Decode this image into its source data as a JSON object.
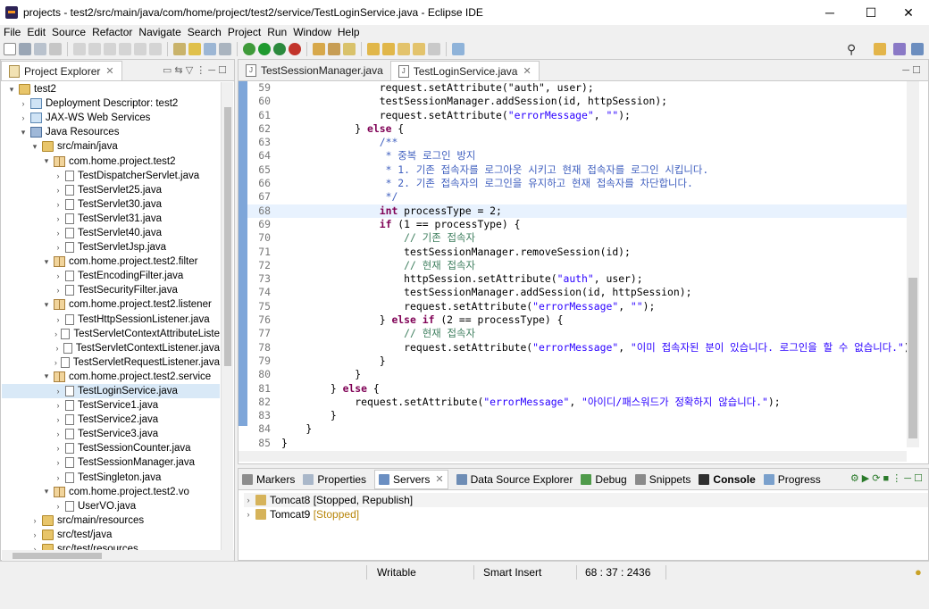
{
  "window": {
    "title": "projects - test2/src/main/java/com/home/project/test2/service/TestLoginService.java - Eclipse IDE",
    "minimize": "─",
    "maximize": "☐",
    "close": "✕"
  },
  "menu": [
    "File",
    "Edit",
    "Source",
    "Refactor",
    "Navigate",
    "Search",
    "Project",
    "Run",
    "Window",
    "Help"
  ],
  "explorer": {
    "tab_label": "Project Explorer",
    "tree": [
      {
        "label": "test2",
        "level": 0,
        "arrow": "▾",
        "icon": "proj"
      },
      {
        "label": "Deployment Descriptor: test2",
        "level": 1,
        "arrow": "›",
        "icon": "desc"
      },
      {
        "label": "JAX-WS Web Services",
        "level": 1,
        "arrow": "›",
        "icon": "desc"
      },
      {
        "label": "Java Resources",
        "level": 1,
        "arrow": "▾",
        "icon": "lib"
      },
      {
        "label": "src/main/java",
        "level": 2,
        "arrow": "▾",
        "icon": "folder"
      },
      {
        "label": "com.home.project.test2",
        "level": 3,
        "arrow": "▾",
        "icon": "pkg"
      },
      {
        "label": "TestDispatcherServlet.java",
        "level": 4,
        "arrow": "›",
        "icon": "jfile"
      },
      {
        "label": "TestServlet25.java",
        "level": 4,
        "arrow": "›",
        "icon": "jfile"
      },
      {
        "label": "TestServlet30.java",
        "level": 4,
        "arrow": "›",
        "icon": "jfile"
      },
      {
        "label": "TestServlet31.java",
        "level": 4,
        "arrow": "›",
        "icon": "jfile"
      },
      {
        "label": "TestServlet40.java",
        "level": 4,
        "arrow": "›",
        "icon": "jfile"
      },
      {
        "label": "TestServletJsp.java",
        "level": 4,
        "arrow": "›",
        "icon": "jfile"
      },
      {
        "label": "com.home.project.test2.filter",
        "level": 3,
        "arrow": "▾",
        "icon": "pkg"
      },
      {
        "label": "TestEncodingFilter.java",
        "level": 4,
        "arrow": "›",
        "icon": "jfile"
      },
      {
        "label": "TestSecurityFilter.java",
        "level": 4,
        "arrow": "›",
        "icon": "jfile"
      },
      {
        "label": "com.home.project.test2.listener",
        "level": 3,
        "arrow": "▾",
        "icon": "pkg"
      },
      {
        "label": "TestHttpSessionListener.java",
        "level": 4,
        "arrow": "›",
        "icon": "jfile"
      },
      {
        "label": "TestServletContextAttributeListe",
        "level": 4,
        "arrow": "›",
        "icon": "jfile"
      },
      {
        "label": "TestServletContextListener.java",
        "level": 4,
        "arrow": "›",
        "icon": "jfile"
      },
      {
        "label": "TestServletRequestListener.java",
        "level": 4,
        "arrow": "›",
        "icon": "jfile"
      },
      {
        "label": "com.home.project.test2.service",
        "level": 3,
        "arrow": "▾",
        "icon": "pkg"
      },
      {
        "label": "TestLoginService.java",
        "level": 4,
        "arrow": "›",
        "icon": "jfile",
        "selected": true
      },
      {
        "label": "TestService1.java",
        "level": 4,
        "arrow": "›",
        "icon": "jfile"
      },
      {
        "label": "TestService2.java",
        "level": 4,
        "arrow": "›",
        "icon": "jfile"
      },
      {
        "label": "TestService3.java",
        "level": 4,
        "arrow": "›",
        "icon": "jfile"
      },
      {
        "label": "TestSessionCounter.java",
        "level": 4,
        "arrow": "›",
        "icon": "jfile"
      },
      {
        "label": "TestSessionManager.java",
        "level": 4,
        "arrow": "›",
        "icon": "jfile"
      },
      {
        "label": "TestSingleton.java",
        "level": 4,
        "arrow": "›",
        "icon": "jfile"
      },
      {
        "label": "com.home.project.test2.vo",
        "level": 3,
        "arrow": "▾",
        "icon": "pkg"
      },
      {
        "label": "UserVO.java",
        "level": 4,
        "arrow": "›",
        "icon": "jfile"
      },
      {
        "label": "src/main/resources",
        "level": 2,
        "arrow": "›",
        "icon": "folder"
      },
      {
        "label": "src/test/java",
        "level": 2,
        "arrow": "›",
        "icon": "folder"
      },
      {
        "label": "src/test/resources",
        "level": 2,
        "arrow": "›",
        "icon": "folder"
      }
    ]
  },
  "editor": {
    "tabs": [
      {
        "label": "TestSessionManager.java",
        "active": false
      },
      {
        "label": "TestLoginService.java",
        "active": true
      }
    ],
    "lines": [
      {
        "n": "59",
        "hl": false,
        "seg": [
          [
            "",
            "                request.setAttribute(\"auth\", user);"
          ]
        ]
      },
      {
        "n": "60",
        "hl": false,
        "seg": [
          [
            "",
            "                testSessionManager.addSession(id, httpSession);"
          ]
        ]
      },
      {
        "n": "61",
        "hl": false,
        "seg": [
          [
            "",
            "                request.setAttribute("
          ],
          [
            "st",
            "\"errorMessage\""
          ],
          [
            "",
            ", "
          ],
          [
            "st",
            "\"\""
          ],
          [
            "",
            ");"
          ]
        ]
      },
      {
        "n": "62",
        "hl": false,
        "seg": [
          [
            "",
            "            } "
          ],
          [
            "kw",
            "else"
          ],
          [
            "",
            " {"
          ]
        ]
      },
      {
        "n": "63",
        "hl": false,
        "seg": [
          [
            "jd",
            "                /**"
          ]
        ]
      },
      {
        "n": "64",
        "hl": false,
        "seg": [
          [
            "jd",
            "                 * 중복 로그인 방지"
          ]
        ]
      },
      {
        "n": "65",
        "hl": false,
        "seg": [
          [
            "jd",
            "                 * 1. 기존 접속자를 로그아웃 시키고 현재 접속자를 로그인 시킵니다."
          ]
        ]
      },
      {
        "n": "66",
        "hl": false,
        "seg": [
          [
            "jd",
            "                 * 2. 기존 접속자의 로그인을 유지하고 현재 접속자를 차단합니다."
          ]
        ]
      },
      {
        "n": "67",
        "hl": false,
        "seg": [
          [
            "jd",
            "                 */"
          ]
        ]
      },
      {
        "n": "68",
        "hl": true,
        "seg": [
          [
            "",
            "                "
          ],
          [
            "kw",
            "int"
          ],
          [
            "",
            " processType = 2;"
          ]
        ]
      },
      {
        "n": "69",
        "hl": false,
        "seg": [
          [
            "",
            "                "
          ],
          [
            "kw",
            "if"
          ],
          [
            "",
            " (1 == processType) {"
          ]
        ]
      },
      {
        "n": "70",
        "hl": false,
        "seg": [
          [
            "cm",
            "                    // 기존 접속자"
          ]
        ]
      },
      {
        "n": "71",
        "hl": false,
        "seg": [
          [
            "",
            "                    testSessionManager.removeSession(id);"
          ]
        ]
      },
      {
        "n": "72",
        "hl": false,
        "seg": [
          [
            "cm",
            "                    // 현재 접속자"
          ]
        ]
      },
      {
        "n": "73",
        "hl": false,
        "seg": [
          [
            "",
            "                    httpSession.setAttribute("
          ],
          [
            "st",
            "\"auth\""
          ],
          [
            "",
            ", user);"
          ]
        ]
      },
      {
        "n": "74",
        "hl": false,
        "seg": [
          [
            "",
            "                    testSessionManager.addSession(id, httpSession);"
          ]
        ]
      },
      {
        "n": "75",
        "hl": false,
        "seg": [
          [
            "",
            "                    request.setAttribute("
          ],
          [
            "st",
            "\"errorMessage\""
          ],
          [
            "",
            ", "
          ],
          [
            "st",
            "\"\""
          ],
          [
            "",
            ");"
          ]
        ]
      },
      {
        "n": "76",
        "hl": false,
        "seg": [
          [
            "",
            "                } "
          ],
          [
            "kw",
            "else if"
          ],
          [
            "",
            " (2 == processType) {"
          ]
        ]
      },
      {
        "n": "77",
        "hl": false,
        "seg": [
          [
            "cm",
            "                    // 현재 접속자"
          ]
        ]
      },
      {
        "n": "78",
        "hl": false,
        "seg": [
          [
            "",
            "                    request.setAttribute("
          ],
          [
            "st",
            "\"errorMessage\""
          ],
          [
            "",
            ", "
          ],
          [
            "st",
            "\"이미 접속자된 분이 있습니다. 로그인을 할 수 없습니다.\""
          ],
          [
            "",
            ");"
          ]
        ]
      },
      {
        "n": "79",
        "hl": false,
        "seg": [
          [
            "",
            "                }"
          ]
        ]
      },
      {
        "n": "80",
        "hl": false,
        "seg": [
          [
            "",
            "            }"
          ]
        ]
      },
      {
        "n": "81",
        "hl": false,
        "seg": [
          [
            "",
            "        } "
          ],
          [
            "kw",
            "else"
          ],
          [
            "",
            " {"
          ]
        ]
      },
      {
        "n": "82",
        "hl": false,
        "seg": [
          [
            "",
            "            request.setAttribute("
          ],
          [
            "st",
            "\"errorMessage\""
          ],
          [
            "",
            ", "
          ],
          [
            "st",
            "\"아이디/패스워드가 정확하지 않습니다.\""
          ],
          [
            "",
            ");"
          ]
        ]
      },
      {
        "n": "83",
        "hl": false,
        "seg": [
          [
            "",
            "        }"
          ]
        ]
      },
      {
        "n": "84",
        "hl": false,
        "seg": [
          [
            "",
            "    }"
          ]
        ]
      },
      {
        "n": "85",
        "hl": false,
        "seg": [
          [
            "",
            "}"
          ]
        ]
      },
      {
        "n": "86",
        "hl": false,
        "seg": [
          [
            "",
            ""
          ]
        ]
      }
    ]
  },
  "bottom": {
    "tabs": [
      "Markers",
      "Properties",
      "Servers",
      "Data Source Explorer",
      "Debug",
      "Snippets",
      "Console",
      "Progress"
    ],
    "active_tab": "Servers",
    "servers": [
      {
        "name": "Tomcat8",
        "state": "[Stopped, Republish]"
      },
      {
        "name": "Tomcat9",
        "state": "[Stopped]"
      }
    ]
  },
  "status": {
    "mode": "Writable",
    "insert": "Smart Insert",
    "position": "68 : 37 : 2436"
  }
}
